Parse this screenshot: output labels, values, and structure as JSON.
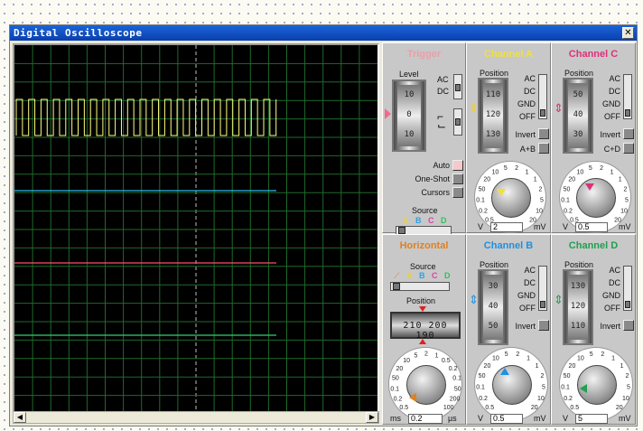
{
  "window": {
    "title": "Digital Oscilloscope",
    "close": "✕"
  },
  "colors": {
    "traceA": "#ffff80",
    "traceB": "#30b8e8",
    "traceC": "#ff4d6d",
    "traceD": "#30d070",
    "gridline": "#1f6a2a"
  },
  "trigger": {
    "title": "Trigger",
    "level_label": "Level",
    "level_ticks": [
      "10",
      "0",
      "10"
    ],
    "coupling": [
      "AC",
      "DC"
    ],
    "modes": [
      "Auto",
      "One-Shot",
      "Cursors"
    ],
    "source_label": "Source",
    "sources": [
      "A",
      "B",
      "C",
      "D"
    ]
  },
  "channel_a": {
    "title": "Channel A",
    "position_label": "Position",
    "ticks": [
      "110",
      "120",
      "130"
    ],
    "coupling": [
      "AC",
      "DC",
      "GND",
      "OFF"
    ],
    "invert": "Invert",
    "combine": "A+B",
    "dial_left": "V",
    "dial_right": "mV",
    "value": "2"
  },
  "channel_c": {
    "title": "Channel C",
    "position_label": "Position",
    "ticks": [
      "50",
      "40",
      "30"
    ],
    "coupling": [
      "AC",
      "DC",
      "GND",
      "OFF"
    ],
    "invert": "Invert",
    "combine": "C+D",
    "dial_left": "V",
    "dial_right": "mV",
    "value": "0.5"
  },
  "horizontal": {
    "title": "Horizontal",
    "source_label": "Source",
    "sources": [
      "A",
      "B",
      "C",
      "D"
    ],
    "position_label": "Position",
    "position_values": "210 200 190",
    "dial_left": "ms",
    "dial_right": "µs",
    "value": "0.2"
  },
  "channel_b": {
    "title": "Channel B",
    "position_label": "Position",
    "ticks": [
      "30",
      "40",
      "50"
    ],
    "coupling": [
      "AC",
      "DC",
      "GND",
      "OFF"
    ],
    "invert": "Invert",
    "dial_left": "V",
    "dial_right": "mV",
    "value": "0.5"
  },
  "channel_d": {
    "title": "Channel D",
    "position_label": "Position",
    "ticks": [
      "130",
      "120",
      "110"
    ],
    "coupling": [
      "AC",
      "DC",
      "GND",
      "OFF"
    ],
    "invert": "Invert",
    "dial_left": "V",
    "dial_right": "mV",
    "value": "5"
  },
  "dial_scale_volts": [
    "0.5",
    "0.2",
    "0.1",
    "50",
    "20",
    "10",
    "5",
    "2",
    "1",
    "1",
    "2",
    "5",
    "10",
    "20"
  ],
  "dial_scale_time": [
    "0.5",
    "0.2",
    "0.1",
    "50",
    "20",
    "10",
    "5",
    "2",
    "1",
    "0.5",
    "0.2",
    "0.1",
    "50",
    "200",
    "100"
  ]
}
